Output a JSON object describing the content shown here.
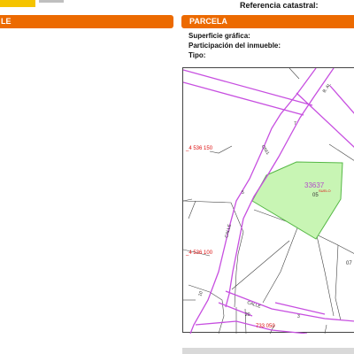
{
  "header": {
    "ref_label": "Referencia catastral:",
    "logo_color": "#f5c400"
  },
  "left_panel": {
    "title": "LE"
  },
  "parcel_panel": {
    "title": "PARCELA",
    "fields": {
      "surface": "Superficie gráfica:",
      "participation": "Participación del inmueble:",
      "type": "Tipo:"
    }
  },
  "map": {
    "parcel_number": "33637",
    "parcel_sub": "05",
    "parcel_use": "SUELO",
    "utm_north_1": "_4 536 150",
    "utm_north_2": "_4 536 100",
    "utm_east": "733 050",
    "street_1": "CALLE",
    "street_2": "CALLE",
    "street_3": "TINO",
    "street_4": "B. AL",
    "lot_07": "07",
    "num_5": "5",
    "num_7": "7",
    "num_3": "3",
    "num_20": "20",
    "num_10": "10",
    "colors": {
      "parcel_fill": "#c8f5b4",
      "parcel_stroke": "#55b845",
      "boundary": "#c74fe0",
      "red_text": "#dd1111",
      "purple_text": "#b24fc8"
    }
  }
}
